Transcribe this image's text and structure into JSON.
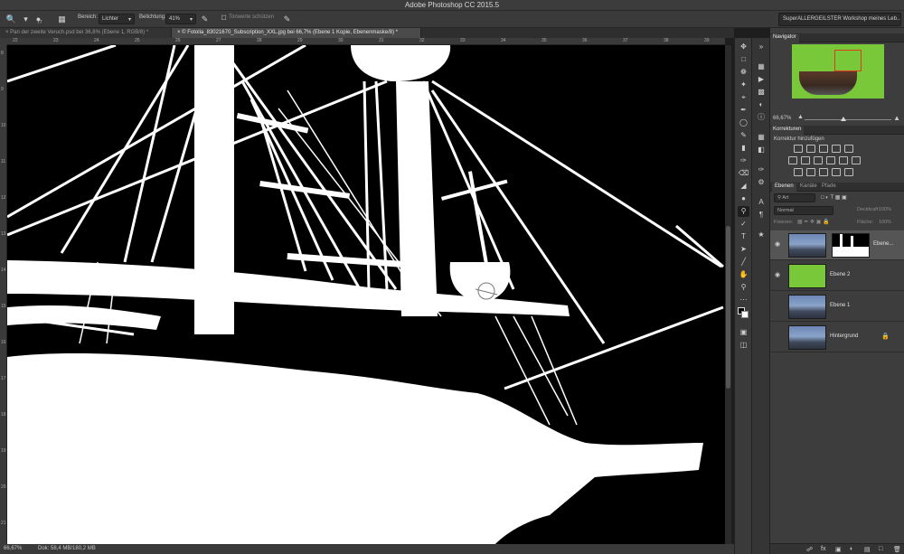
{
  "window": {
    "title": "Adobe Photoshop CC 2015.5"
  },
  "options_bar": {
    "range_label": "Bereich:",
    "range_value": "Lichter",
    "exposure_label": "Belichtung:",
    "exposure_value": "41%",
    "protect_tones_label": "Tonwerte schützen",
    "brush_size": "77",
    "workspace": "SuperALLERGEILSTER Workshop meines Leb..."
  },
  "tabs": [
    {
      "label": "Pan der zweite Veruch.psd bei 36,8% (Ebene 1, RGB/8) *"
    },
    {
      "label": "© Fotolia_83021670_Subscription_XXL.jpg bei 66,7% (Ebene 1 Kopie, Ebenenmaske/8) *"
    }
  ],
  "ruler": {
    "h_labels": [
      "22",
      "23",
      "24",
      "25",
      "26",
      "27",
      "28",
      "29",
      "30",
      "31",
      "32",
      "33",
      "34",
      "35",
      "36",
      "37",
      "38",
      "39"
    ],
    "v_labels": [
      "8",
      "9",
      "10",
      "11",
      "12",
      "13",
      "14",
      "15",
      "16",
      "17",
      "18",
      "19",
      "20",
      "21"
    ]
  },
  "status": {
    "zoom": "66,67%",
    "doc": "Dok: 58,4 MB/180,2 MB"
  },
  "navigator": {
    "title": "Navigator",
    "zoom": "66,67%"
  },
  "corrections": {
    "title": "Korrekturen",
    "add_label": "Korrektur hinzufügen"
  },
  "layers_panel": {
    "tabs": [
      "Ebenen",
      "Kanäle",
      "Pfade"
    ],
    "filter": "Art",
    "blend_mode": "Normal",
    "opacity_label": "Deckkraft:",
    "opacity_value": "100%",
    "lock_label": "Fixieren:",
    "fill_label": "Fläche:",
    "fill_value": "100%",
    "layers": [
      {
        "name": "Ebene...",
        "type": "image-mask",
        "selected": true
      },
      {
        "name": "Ebene 2",
        "type": "color"
      },
      {
        "name": "Ebene 1",
        "type": "image"
      },
      {
        "name": "Hintergrund",
        "type": "image",
        "locked": true
      }
    ]
  },
  "colors": {
    "accent_green": "#78c83a",
    "nav_rect": "#e23a1e"
  }
}
